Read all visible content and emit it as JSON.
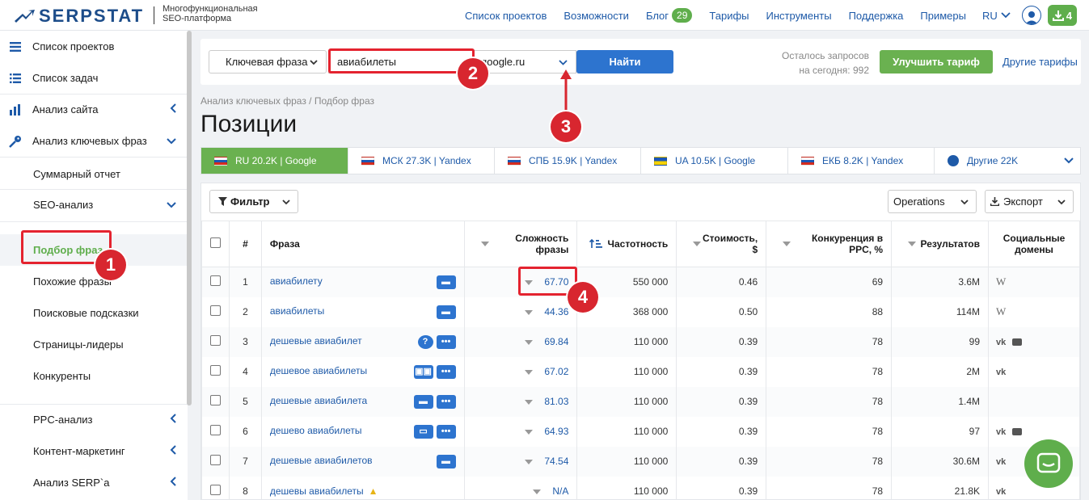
{
  "brand": {
    "name": "SERPSTAT",
    "sub_line1": "Многофункциональная",
    "sub_line2": "SEO-платформа"
  },
  "topnav": {
    "projects": "Список проектов",
    "features": "Возможности",
    "blog": "Блог",
    "blog_count": "29",
    "tariffs": "Тарифы",
    "tools": "Инструменты",
    "support": "Поддержка",
    "examples": "Примеры",
    "lang": "RU",
    "downloads": "4"
  },
  "sidebar": {
    "projects": "Список проектов",
    "tasks": "Список задач",
    "site_analysis": "Анализ сайта",
    "kw_analysis": "Анализ ключевых фраз",
    "summary": "Суммарный отчет",
    "seo_analysis": "SEO-анализ",
    "phrase_selection": "Подбор фраз",
    "similar": "Похожие фразы",
    "suggestions": "Поисковые подсказки",
    "leaders": "Страницы-лидеры",
    "competitors": "Конкуренты",
    "ppc": "PPC-анализ",
    "content": "Контент-маркетинг",
    "serp": "Анализ SERP`а"
  },
  "search": {
    "type_label": "Ключевая фраза",
    "query": "авиабилеты",
    "database": "google.ru",
    "find_label": "Найти",
    "quota_line1": "Осталось запросов",
    "quota_line2": "на сегодня: 992",
    "upgrade_label": "Улучшить тариф",
    "other_tariffs": "Другие тарифы"
  },
  "breadcrumb": "Анализ ключевых фраз / Подбор фраз",
  "page_title": "Позиции",
  "tabs": [
    {
      "label": "RU 20.2K | Google",
      "flag": "ru"
    },
    {
      "label": "МСК 27.3K | Yandex",
      "flag": "ru"
    },
    {
      "label": "СПБ 15.9K | Yandex",
      "flag": "ru"
    },
    {
      "label": "UA 10.5K | Google",
      "flag": "ua"
    },
    {
      "label": "ЕКБ 8.2K | Yandex",
      "flag": "ru"
    },
    {
      "label": "Другие 22K",
      "flag": "globe"
    }
  ],
  "toolbar": {
    "filter": "Фильтр",
    "operations": "Operations",
    "export": "Экспорт"
  },
  "columns": {
    "num": "#",
    "phrase": "Фраза",
    "difficulty_1": "Сложность",
    "difficulty_2": "фразы",
    "frequency": "Частотность",
    "cost_1": "Стоимость,",
    "cost_2": "$",
    "competition_1": "Конкуренция в",
    "competition_2": "PPC, %",
    "results": "Результатов",
    "social_1": "Социальные",
    "social_2": "домены"
  },
  "rows": [
    {
      "num": "1",
      "phrase": "авиабилету",
      "difficulty": "67.70",
      "frequency": "550 000",
      "cost": "0.46",
      "competition": "69",
      "results": "3.6M"
    },
    {
      "num": "2",
      "phrase": "авиабилеты",
      "difficulty": "44.36",
      "frequency": "368 000",
      "cost": "0.50",
      "competition": "88",
      "results": "114M"
    },
    {
      "num": "3",
      "phrase": "дешевые авиабилет",
      "difficulty": "69.84",
      "frequency": "110 000",
      "cost": "0.39",
      "competition": "78",
      "results": "99"
    },
    {
      "num": "4",
      "phrase": "дешевое авиабилеты",
      "difficulty": "67.02",
      "frequency": "110 000",
      "cost": "0.39",
      "competition": "78",
      "results": "2M"
    },
    {
      "num": "5",
      "phrase": "дешевые авиабилета",
      "difficulty": "81.03",
      "frequency": "110 000",
      "cost": "0.39",
      "competition": "78",
      "results": "1.4M"
    },
    {
      "num": "6",
      "phrase": "дешево авиабилеты",
      "difficulty": "64.93",
      "frequency": "110 000",
      "cost": "0.39",
      "competition": "78",
      "results": "97"
    },
    {
      "num": "7",
      "phrase": "дешевые авиабилетов",
      "difficulty": "74.54",
      "frequency": "110 000",
      "cost": "0.39",
      "competition": "78",
      "results": "30.6M"
    },
    {
      "num": "8",
      "phrase": "дешевы авиабилеты",
      "difficulty": "N/A",
      "frequency": "110 000",
      "cost": "0.39",
      "competition": "78",
      "results": "21.8K"
    }
  ],
  "annotations": {
    "a1": "1",
    "a2": "2",
    "a3": "3",
    "a4": "4"
  },
  "colors": {
    "accent_blue": "#2d74cf",
    "accent_green": "#6ab150",
    "annotation_red": "#d8262f"
  }
}
